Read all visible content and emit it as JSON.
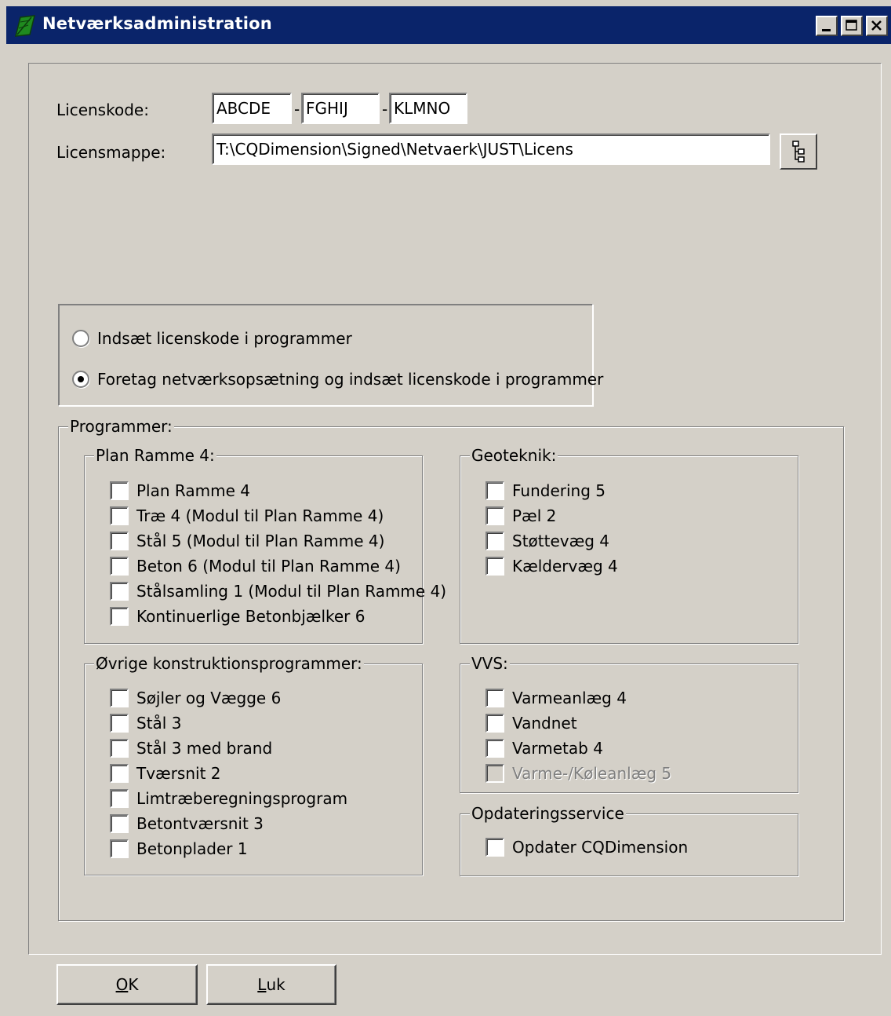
{
  "window": {
    "title": "Netværksadministration",
    "icon": "leaf-icon"
  },
  "license": {
    "code_label": "Licenskode:",
    "code_parts": [
      "ABCDE",
      "FGHIJ",
      "KLMNO"
    ],
    "separator": "-",
    "folder_label": "Licensmappe:",
    "folder_value": "T:\\CQDimension\\Signed\\Netvaerk\\JUST\\Licens",
    "browse_icon": "folder-tree-icon"
  },
  "mode": {
    "options": [
      {
        "label": "Indsæt licenskode i programmer",
        "checked": false
      },
      {
        "label": "Foretag netværksopsætning og indsæt licenskode i programmer",
        "checked": true
      }
    ]
  },
  "programs": {
    "title": "Programmer:",
    "plan_ramme": {
      "title": "Plan Ramme 4:",
      "items": [
        "Plan Ramme 4",
        "Træ 4 (Modul til Plan Ramme 4)",
        "Stål 5 (Modul til Plan Ramme 4)",
        "Beton 6 (Modul til Plan Ramme 4)",
        "Stålsamling 1 (Modul til Plan Ramme 4)",
        "Kontinuerlige Betonbjælker 6"
      ]
    },
    "geoteknik": {
      "title": "Geoteknik:",
      "items": [
        "Fundering 5",
        "Pæl 2",
        "Støttevæg 4",
        "Kældervæg 4"
      ]
    },
    "ovrige": {
      "title": "Øvrige konstruktionsprogrammer:",
      "items": [
        "Søjler og Vægge 6",
        "Stål 3",
        "Stål 3 med brand",
        "Tværsnit 2",
        "Limtræberegningsprogram",
        "Betontværsnit 3",
        "Betonplader 1"
      ]
    },
    "vvs": {
      "title": "VVS:",
      "items": [
        "Varmeanlæg 4",
        "Vandnet",
        "Varmetab 4",
        "Varme-/Køleanlæg 5"
      ]
    },
    "opdatering": {
      "title": "Opdateringsservice",
      "items": [
        "Opdater CQDimension"
      ]
    }
  },
  "buttons": {
    "ok_mnemonic": "O",
    "ok_rest": "K",
    "luk_mnemonic": "L",
    "luk_rest": "uk"
  }
}
